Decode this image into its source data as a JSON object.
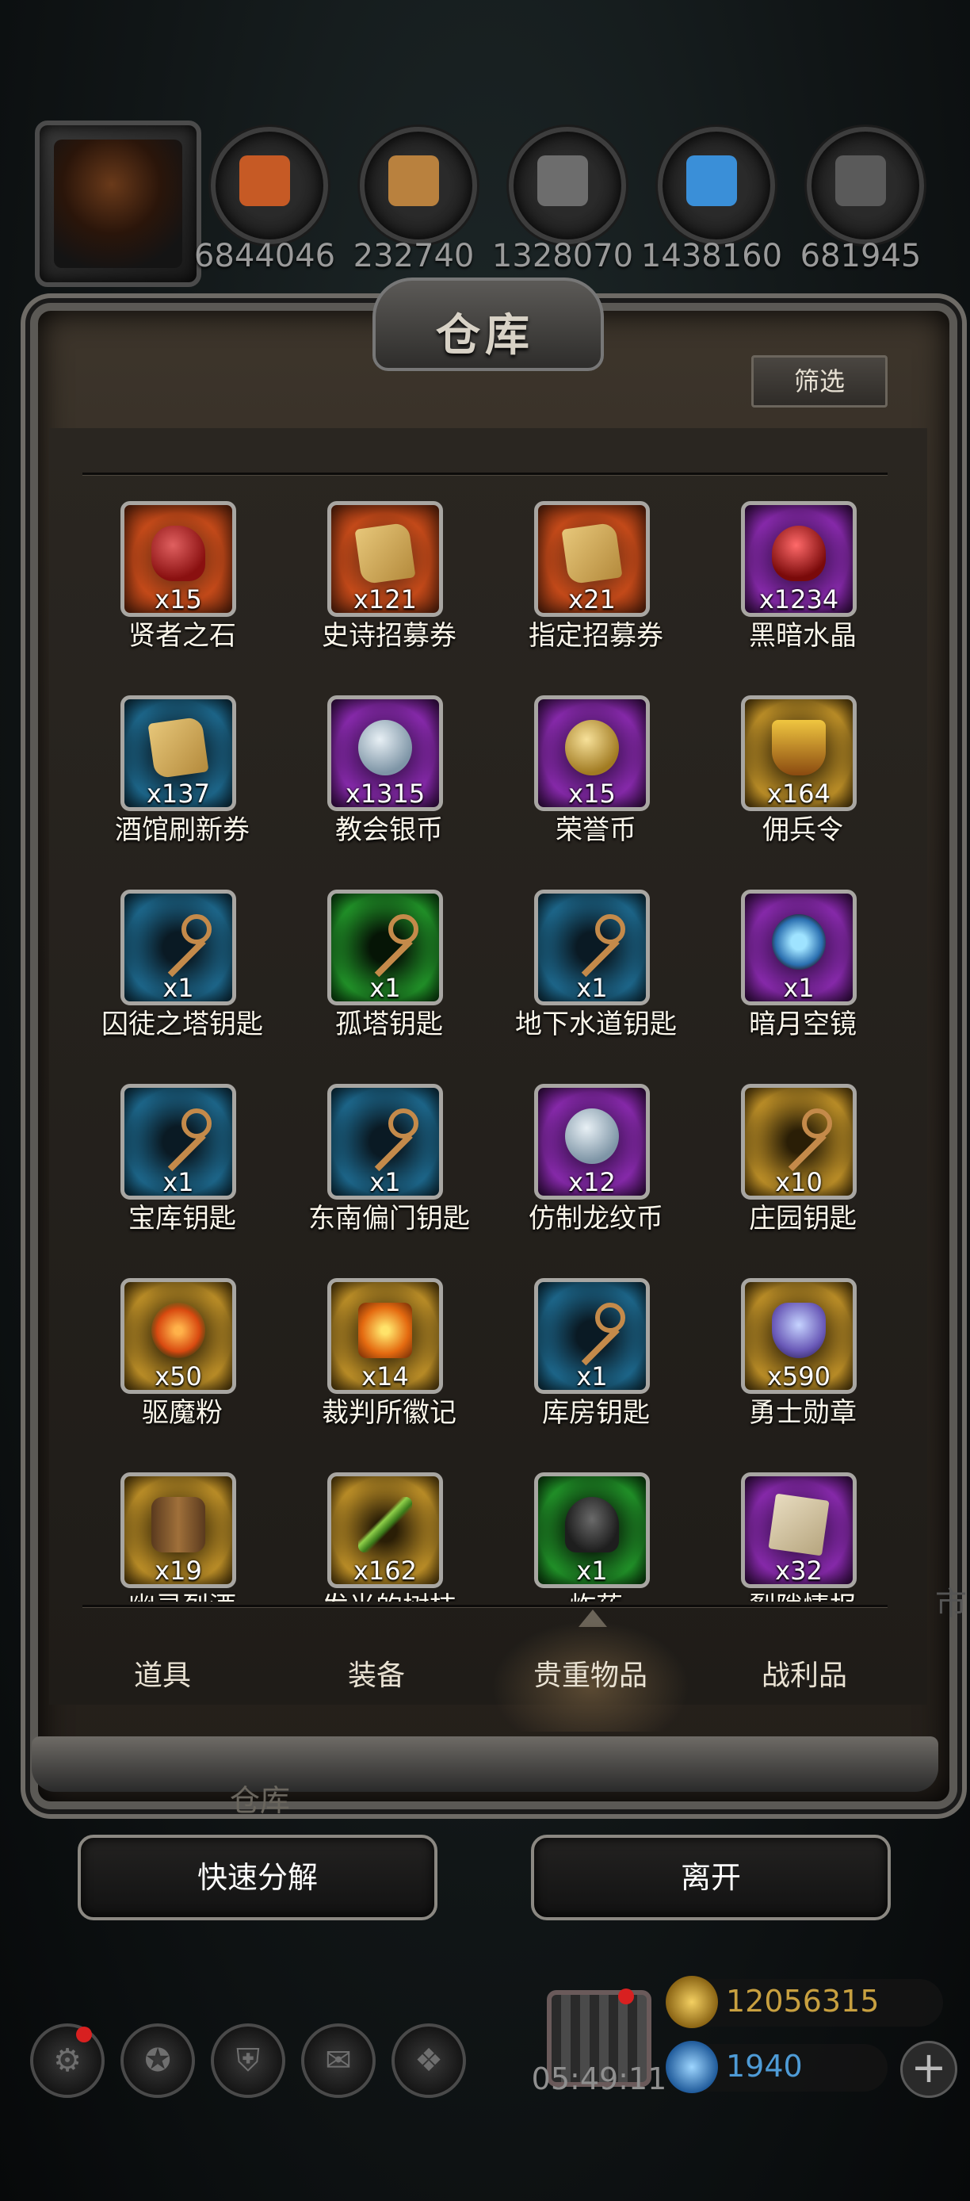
{
  "resources": [
    {
      "icon": "leather-icon",
      "value": "6844046",
      "color": "#c65a25"
    },
    {
      "icon": "wood-icon",
      "value": "232740",
      "color": "#b9813e"
    },
    {
      "icon": "iron-icon",
      "value": "1328070",
      "color": "#6d6d6d"
    },
    {
      "icon": "crystal-icon",
      "value": "1438160",
      "color": "#3a8fd8"
    },
    {
      "icon": "stone-icon",
      "value": "681945",
      "color": "#5a5a5a"
    }
  ],
  "panel": {
    "title": "仓库",
    "filter_label": "筛选"
  },
  "items": [
    {
      "name": "贤者之石",
      "qty": "x15",
      "frame": "orange",
      "pic": "stone"
    },
    {
      "name": "史诗招募券",
      "qty": "x121",
      "frame": "orange",
      "pic": "scroll"
    },
    {
      "name": "指定招募券",
      "qty": "x21",
      "frame": "orange",
      "pic": "scroll"
    },
    {
      "name": "黑暗水晶",
      "qty": "x1234",
      "frame": "purple",
      "pic": "crystal"
    },
    {
      "name": "酒馆刷新券",
      "qty": "x137",
      "frame": "blue",
      "pic": "scroll"
    },
    {
      "name": "教会银币",
      "qty": "x1315",
      "frame": "purple",
      "pic": "coin-s"
    },
    {
      "name": "荣誉币",
      "qty": "x15",
      "frame": "purple",
      "pic": "coin-g"
    },
    {
      "name": "佣兵令",
      "qty": "x164",
      "frame": "gold",
      "pic": "badge"
    },
    {
      "name": "囚徒之塔钥匙",
      "qty": "x1",
      "frame": "blue",
      "pic": "key"
    },
    {
      "name": "孤塔钥匙",
      "qty": "x1",
      "frame": "green",
      "pic": "key"
    },
    {
      "name": "地下水道钥匙",
      "qty": "x1",
      "frame": "blue",
      "pic": "key"
    },
    {
      "name": "暗月空镜",
      "qty": "x1",
      "frame": "purple",
      "pic": "mirror"
    },
    {
      "name": "宝库钥匙",
      "qty": "x1",
      "frame": "blue",
      "pic": "key"
    },
    {
      "name": "东南偏门钥匙",
      "qty": "x1",
      "frame": "blue",
      "pic": "key"
    },
    {
      "name": "仿制龙纹币",
      "qty": "x12",
      "frame": "purple",
      "pic": "coin-s"
    },
    {
      "name": "庄园钥匙",
      "qty": "x10",
      "frame": "gold",
      "pic": "key"
    },
    {
      "name": "驱魔粉",
      "qty": "x50",
      "frame": "gold",
      "pic": "powder"
    },
    {
      "name": "裁判所徽记",
      "qty": "x14",
      "frame": "gold",
      "pic": "emblem"
    },
    {
      "name": "库房钥匙",
      "qty": "x1",
      "frame": "blue",
      "pic": "key"
    },
    {
      "name": "勇士勋章",
      "qty": "x590",
      "frame": "gold",
      "pic": "medal"
    },
    {
      "name": "幽灵烈酒",
      "qty": "x19",
      "frame": "gold",
      "pic": "barrel"
    },
    {
      "name": "发光的树枝",
      "qty": "x162",
      "frame": "gold",
      "pic": "twig"
    },
    {
      "name": "炸药",
      "qty": "x1",
      "frame": "green",
      "pic": "rock"
    },
    {
      "name": "裂隙情报",
      "qty": "x32",
      "frame": "purple",
      "pic": "note"
    }
  ],
  "tabs": [
    "道具",
    "装备",
    "贵重物品",
    "战利品"
  ],
  "active_tab": "贵重物品",
  "ghost_label": "仓库",
  "buttons": {
    "decompose": "快速分解",
    "leave": "离开"
  },
  "hud": {
    "icons": [
      "settings-icon",
      "emblem-icon",
      "shield-icon",
      "mail-icon",
      "cube-icon"
    ],
    "timer": "05:49:11",
    "gold": "12056315",
    "gems": "1940",
    "side_text": "市"
  }
}
